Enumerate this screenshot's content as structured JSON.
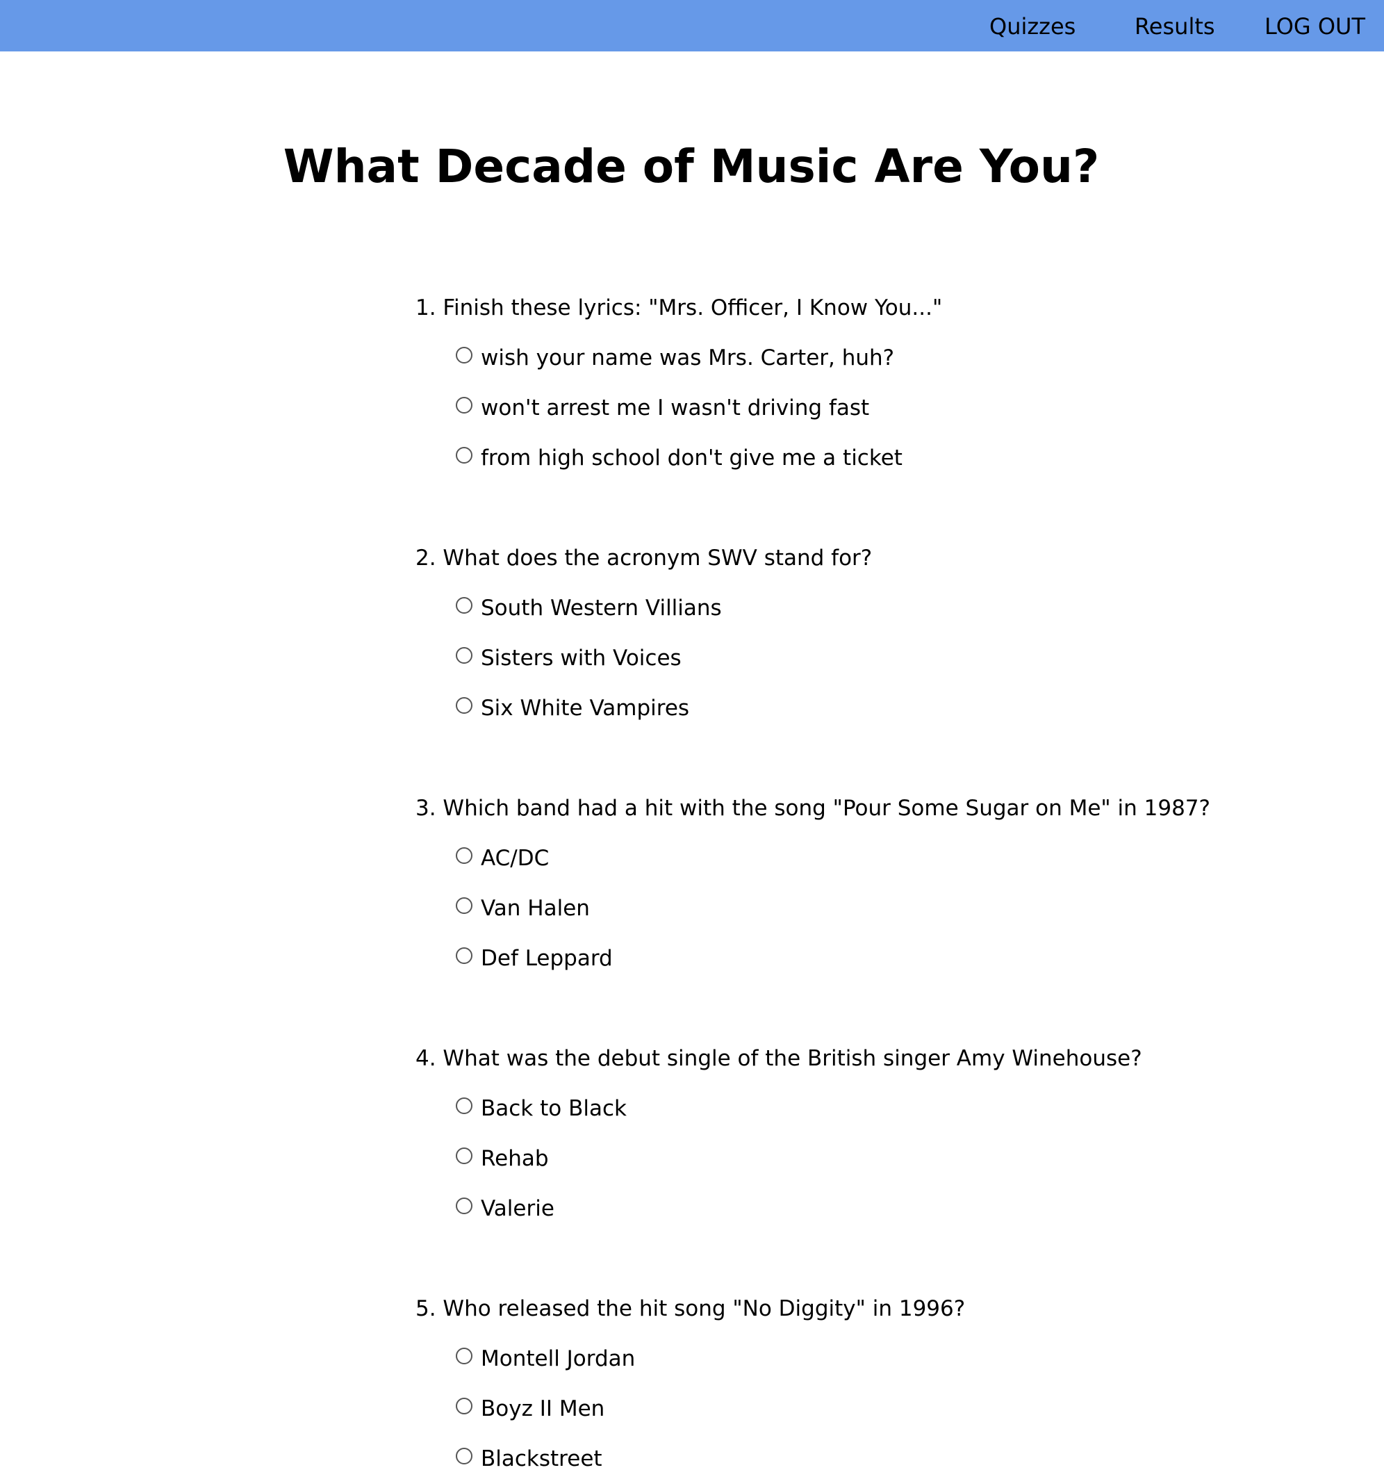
{
  "nav": {
    "quizzes": "Quizzes",
    "results": "Results",
    "logout": "LOG OUT"
  },
  "quiz": {
    "title": "What Decade of Music Are You?",
    "questions": [
      {
        "text": "1. Finish these lyrics: \"Mrs. Officer, I Know You...\"",
        "options": [
          "wish your name was Mrs. Carter, huh?",
          "won't arrest me I wasn't driving fast",
          "from high school don't give me a ticket"
        ]
      },
      {
        "text": "2. What does the acronym SWV stand for?",
        "options": [
          "South Western Villians",
          "Sisters with Voices",
          "Six White Vampires"
        ]
      },
      {
        "text": "3. Which band had a hit with the song \"Pour Some Sugar on Me\" in 1987?",
        "options": [
          "AC/DC",
          "Van Halen",
          "Def Leppard"
        ]
      },
      {
        "text": "4. What was the debut single of the British singer Amy Winehouse?",
        "options": [
          "Back to Black",
          "Rehab",
          "Valerie"
        ]
      },
      {
        "text": "5. Who released the hit song \"No Diggity\" in 1996?",
        "options": [
          "Montell Jordan",
          "Boyz II Men",
          "Blackstreet"
        ]
      }
    ]
  },
  "colors": {
    "nav_background": "#6699e8",
    "page_background": "#ffffff",
    "text": "#000000"
  }
}
